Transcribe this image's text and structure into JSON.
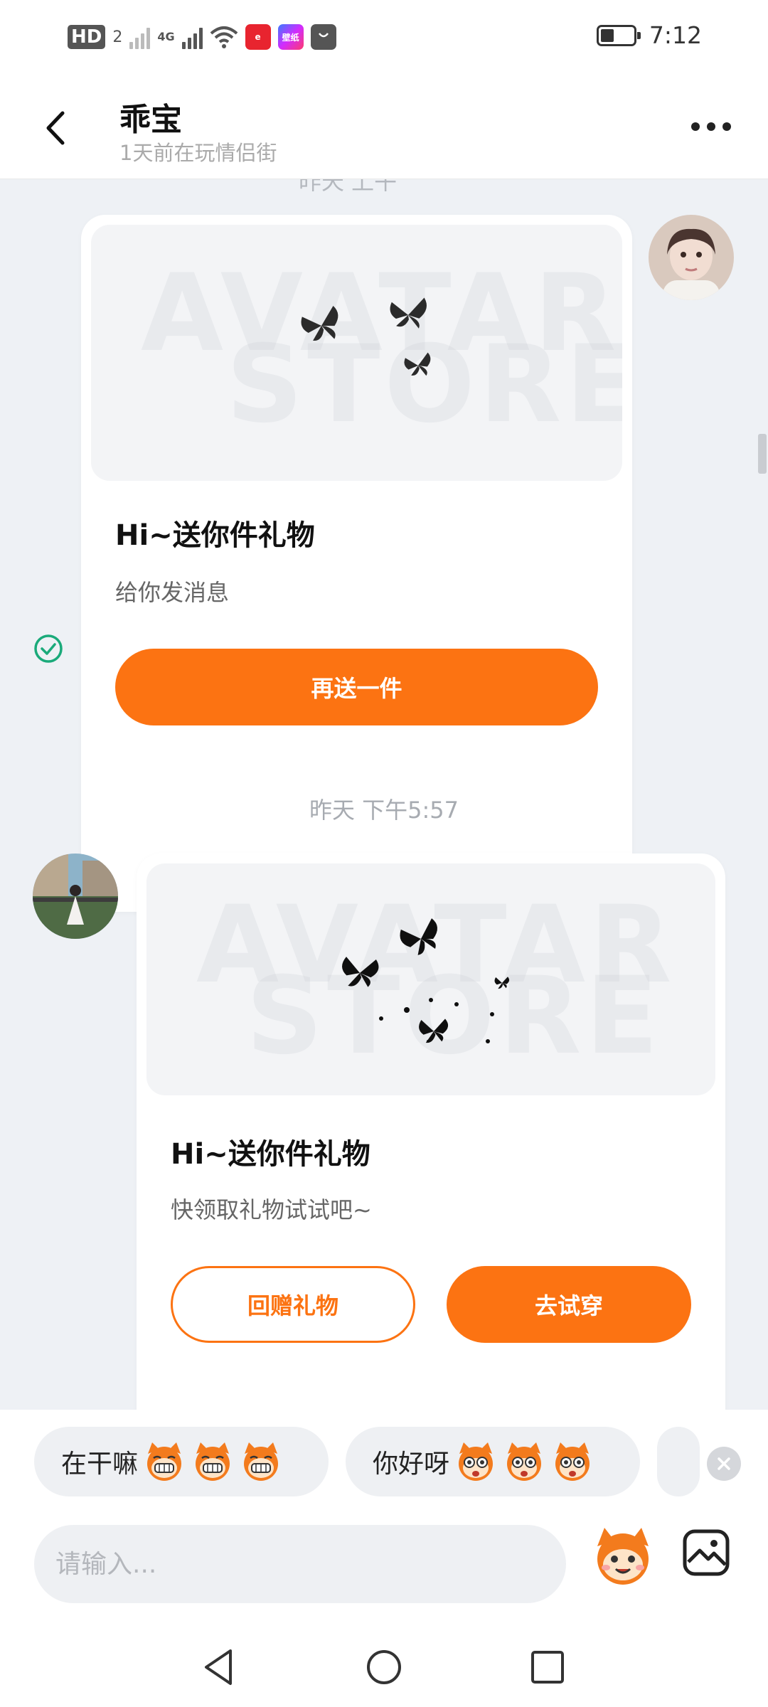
{
  "status_bar": {
    "hd": "HD",
    "sim": "2",
    "network": "4G",
    "app1_label": "淘宝直播",
    "app2_label": "壁纸",
    "time": "7:12"
  },
  "header": {
    "title": "乖宝",
    "subtitle": "1天前在玩情侣街"
  },
  "chat": {
    "cut_off_text": "昨天 上午",
    "messages": [
      {
        "watermark_line1": "AVATAR",
        "watermark_line2": "STORE",
        "title": "Hi~送你件礼物",
        "desc": "给你发消息",
        "button": "再送一件"
      },
      {
        "timestamp": "昨天 下午5:57",
        "watermark_line1": "AVATAR",
        "watermark_line2": "STORE",
        "title": "Hi~送你件礼物",
        "desc": "快领取礼物试试吧~",
        "button_secondary": "回赠礼物",
        "button_primary": "去试穿"
      }
    ]
  },
  "quick_replies": [
    {
      "text": "在干嘛",
      "emoji": "grin-monkey-icon"
    },
    {
      "text": "你好呀",
      "emoji": "wide-eye-monkey-icon"
    }
  ],
  "input": {
    "placeholder": "请输入..."
  },
  "colors": {
    "accent": "#fc7312",
    "check": "#1aaa7a",
    "background": "#eef1f5"
  }
}
